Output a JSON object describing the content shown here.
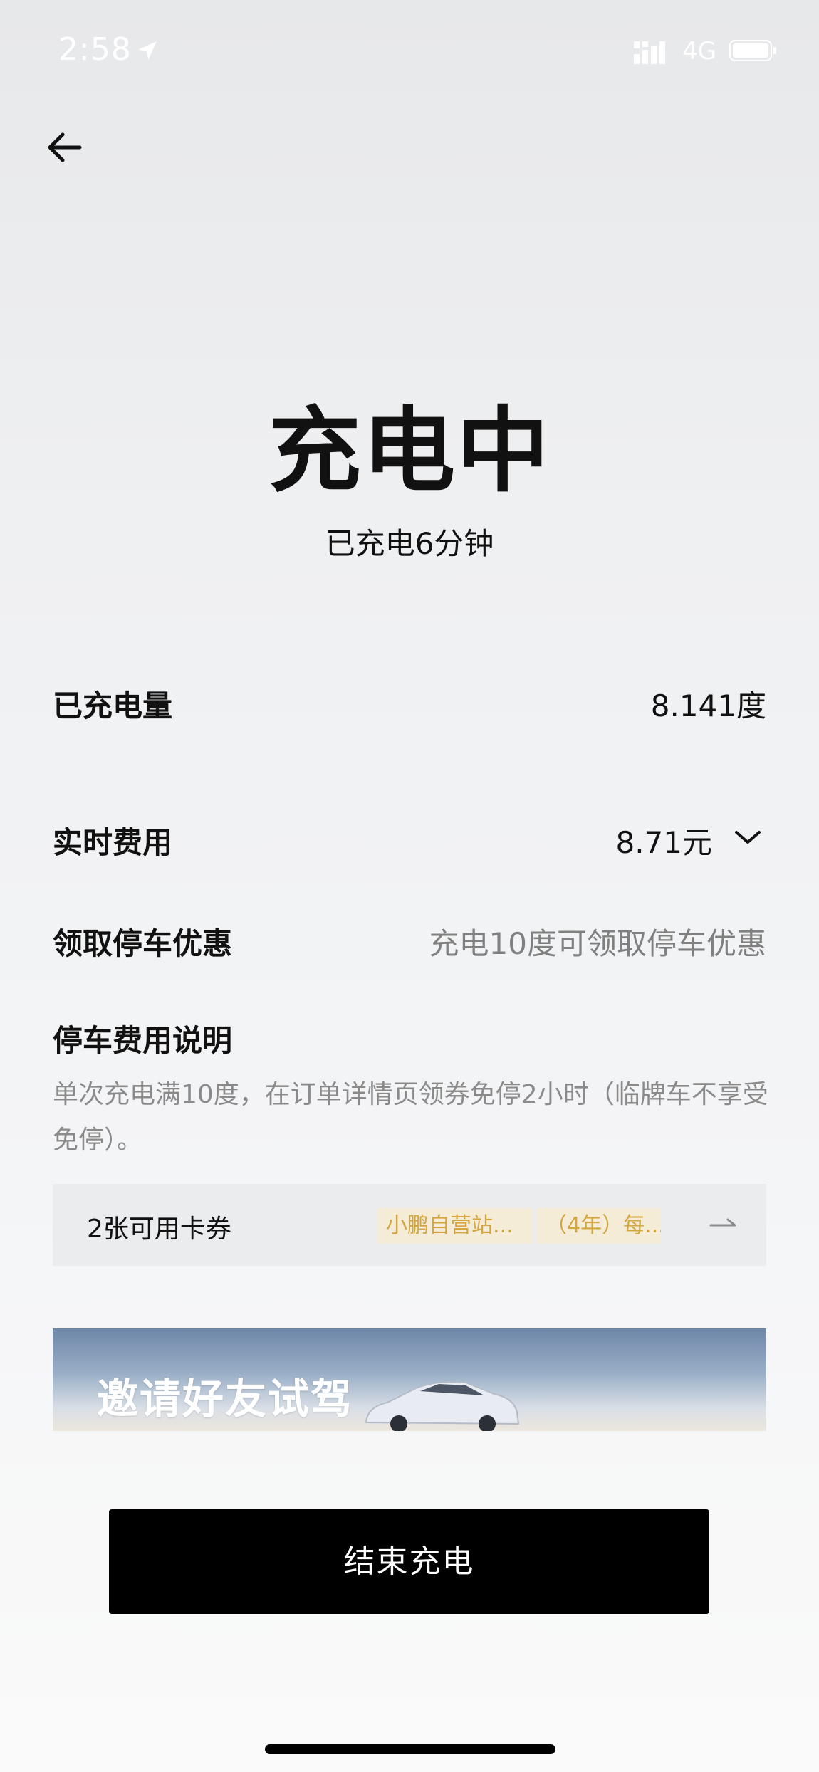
{
  "status_bar": {
    "time": "2:58",
    "network": "4G"
  },
  "page": {
    "title": "充电中",
    "subtitle": "已充电6分钟"
  },
  "rows": {
    "energy": {
      "label": "已充电量",
      "value": "8.141度"
    },
    "cost": {
      "label": "实时费用",
      "value": "8.71元"
    },
    "parking_offer": {
      "label": "领取停车优惠",
      "value": "充电10度可领取停车优惠"
    }
  },
  "parking_note": {
    "title": "停车费用说明",
    "text": "单次充电满10度，在订单详情页领券免停2小时（临牌车不享受免停）。"
  },
  "coupons": {
    "label": "2张可用卡券",
    "tags": [
      "小鹏自营站...",
      "（4年）每..."
    ]
  },
  "banner": {
    "text": "邀请好友试驾"
  },
  "end_button": {
    "label": "结束充电"
  },
  "icons": {
    "back": "back-arrow-icon",
    "location": "location-arrow-icon",
    "signal": "cellular-signal-icon",
    "battery": "battery-icon",
    "expand": "chevron-down-icon",
    "coupon": "arrow-right-icon"
  },
  "colors": {
    "tag_text": "#d4a640",
    "tag_bg": "#f5ecd7",
    "button": "#000000"
  }
}
